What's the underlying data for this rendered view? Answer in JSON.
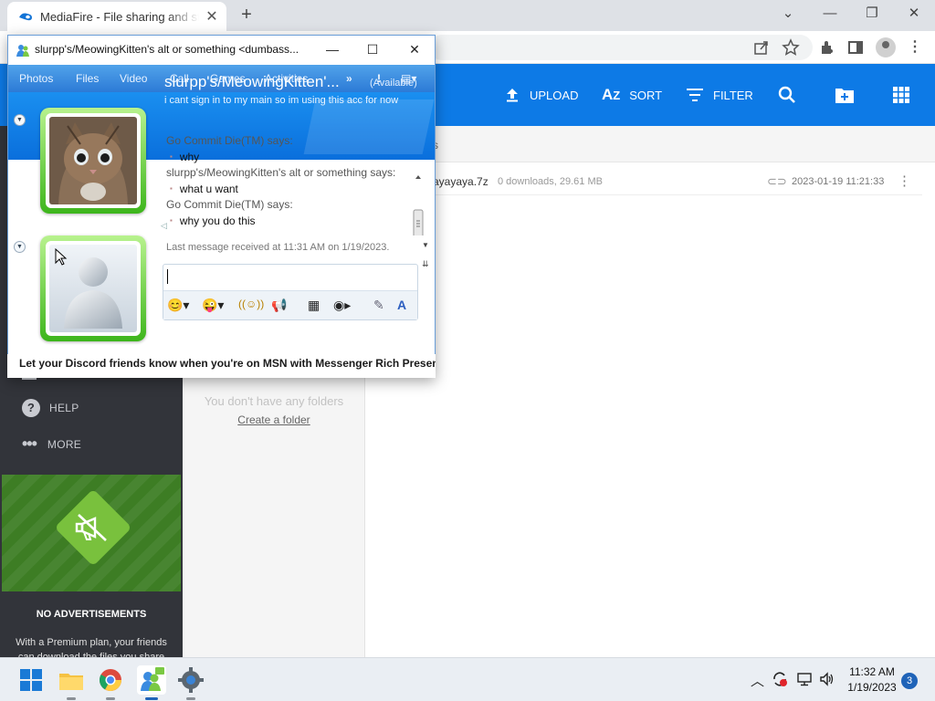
{
  "browser": {
    "tab_title": "MediaFire - File sharing and storage",
    "new_tab": "+",
    "controls": {
      "minimize": "—",
      "restore": "❐",
      "close": "✕",
      "tabs_menu": "⌄"
    }
  },
  "mediafire": {
    "header": {
      "upload": "UPLOAD",
      "sort": "SORT",
      "filter": "FILTER"
    },
    "subheader_fragment": "s",
    "sidebar": {
      "help": "HELP",
      "more": "MORE",
      "promo_title": "NO ADVERTISEMENTS",
      "promo_text": "With a Premium plan, your friends can download the files you share"
    },
    "folders": {
      "empty_text": "You don't have any folders",
      "create_link": "Create a folder"
    },
    "file": {
      "name": "ayayaya.7z",
      "meta": "0 downloads, 29.61 MB",
      "date": "2023-01-19 11:21:33"
    }
  },
  "messenger": {
    "window_title": "slurpp's/MeowingKitten's alt or something <dumbass...",
    "menu": [
      "Photos",
      "Files",
      "Video",
      "Call",
      "Games",
      "Activities"
    ],
    "contact": {
      "name": "slurpp's/MeowingKitten'...",
      "status": "(Available)",
      "personal_message": "i cant sign in to my main so im using this acc for now"
    },
    "chat": [
      {
        "sender": "Go Commit Die(TM) says:",
        "messages": [
          "why"
        ]
      },
      {
        "sender": "slurpp's/MeowingKitten's alt or something says:",
        "messages": [
          "what u want"
        ]
      },
      {
        "sender": "Go Commit Die(TM) says:",
        "messages": [
          "why you do this"
        ]
      }
    ],
    "last_message": "Last message received at 11:31 AM on 1/19/2023.",
    "ad": "Let your Discord friends know when you're on MSN with Messenger Rich Presence"
  },
  "taskbar": {
    "time": "11:32 AM",
    "date": "1/19/2023",
    "notifications": "3"
  }
}
